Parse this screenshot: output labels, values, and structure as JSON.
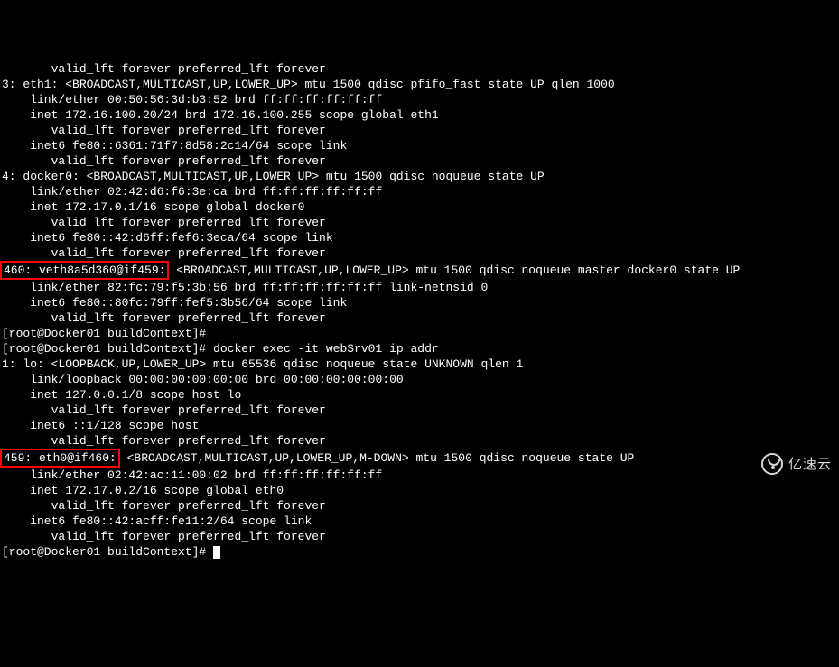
{
  "lines": [
    {
      "indent": 7,
      "text": "valid_lft forever preferred_lft forever"
    },
    {
      "indent": 0,
      "text": "3: eth1: <BROADCAST,MULTICAST,UP,LOWER_UP> mtu 1500 qdisc pfifo_fast state UP qlen 1000"
    },
    {
      "indent": 4,
      "text": "link/ether 00:50:56:3d:b3:52 brd ff:ff:ff:ff:ff:ff"
    },
    {
      "indent": 4,
      "text": "inet 172.16.100.20/24 brd 172.16.100.255 scope global eth1"
    },
    {
      "indent": 7,
      "text": "valid_lft forever preferred_lft forever"
    },
    {
      "indent": 4,
      "text": "inet6 fe80::6361:71f7:8d58:2c14/64 scope link"
    },
    {
      "indent": 7,
      "text": "valid_lft forever preferred_lft forever"
    },
    {
      "indent": 0,
      "text": "4: docker0: <BROADCAST,MULTICAST,UP,LOWER_UP> mtu 1500 qdisc noqueue state UP"
    },
    {
      "indent": 4,
      "text": "link/ether 02:42:d6:f6:3e:ca brd ff:ff:ff:ff:ff:ff"
    },
    {
      "indent": 4,
      "text": "inet 172.17.0.1/16 scope global docker0"
    },
    {
      "indent": 7,
      "text": "valid_lft forever preferred_lft forever"
    },
    {
      "indent": 4,
      "text": "inet6 fe80::42:d6ff:fef6:3eca/64 scope link"
    },
    {
      "indent": 7,
      "text": "valid_lft forever preferred_lft forever"
    },
    {
      "indent": 0,
      "highlight": "460: veth8a5d360@if459:",
      "rest": " <BROADCAST,MULTICAST,UP,LOWER_UP> mtu 1500 qdisc noqueue master docker0 state UP"
    },
    {
      "indent": 4,
      "text": "link/ether 82:fc:79:f5:3b:56 brd ff:ff:ff:ff:ff:ff link-netnsid 0"
    },
    {
      "indent": 4,
      "text": "inet6 fe80::80fc:79ff:fef5:3b56/64 scope link"
    },
    {
      "indent": 7,
      "text": "valid_lft forever preferred_lft forever"
    },
    {
      "indent": 0,
      "text": "[root@Docker01 buildContext]#"
    },
    {
      "indent": 0,
      "text": "[root@Docker01 buildContext]# docker exec -it webSrv01 ip addr"
    },
    {
      "indent": 0,
      "text": "1: lo: <LOOPBACK,UP,LOWER_UP> mtu 65536 qdisc noqueue state UNKNOWN qlen 1"
    },
    {
      "indent": 4,
      "text": "link/loopback 00:00:00:00:00:00 brd 00:00:00:00:00:00"
    },
    {
      "indent": 4,
      "text": "inet 127.0.0.1/8 scope host lo"
    },
    {
      "indent": 7,
      "text": "valid_lft forever preferred_lft forever"
    },
    {
      "indent": 4,
      "text": "inet6 ::1/128 scope host"
    },
    {
      "indent": 7,
      "text": "valid_lft forever preferred_lft forever"
    },
    {
      "indent": 0,
      "highlight": "459: eth0@if460:",
      "rest": " <BROADCAST,MULTICAST,UP,LOWER_UP,M-DOWN> mtu 1500 qdisc noqueue state UP"
    },
    {
      "indent": 4,
      "text": "link/ether 02:42:ac:11:00:02 brd ff:ff:ff:ff:ff:ff"
    },
    {
      "indent": 4,
      "text": "inet 172.17.0.2/16 scope global eth0"
    },
    {
      "indent": 7,
      "text": "valid_lft forever preferred_lft forever"
    },
    {
      "indent": 4,
      "text": "inet6 fe80::42:acff:fe11:2/64 scope link"
    },
    {
      "indent": 7,
      "text": "valid_lft forever preferred_lft forever"
    },
    {
      "indent": 0,
      "text": "[root@Docker01 buildContext]# ",
      "cursor": true
    }
  ],
  "watermark": "亿速云"
}
